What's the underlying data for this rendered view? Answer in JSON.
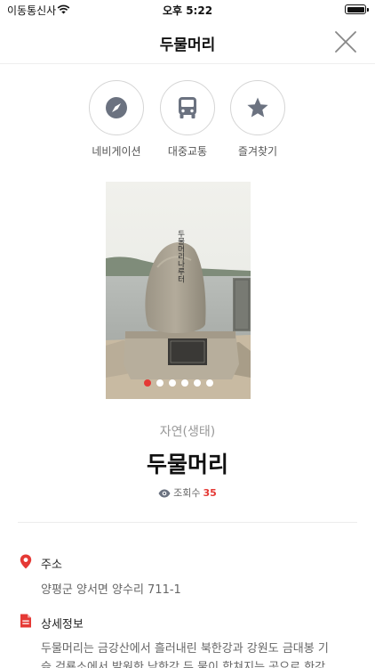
{
  "status_bar": {
    "carrier": "이동통신사",
    "time": "오후 5:22"
  },
  "nav": {
    "title": "두물머리"
  },
  "actions": [
    {
      "label": "네비게이션",
      "icon": "compass-icon"
    },
    {
      "label": "대중교통",
      "icon": "bus-icon"
    },
    {
      "label": "즐겨찾기",
      "icon": "star-icon"
    }
  ],
  "photo": {
    "stone_text": "두물머리나루터",
    "slide_count": 6,
    "active_slide": 1
  },
  "place": {
    "category": "자연(생태)",
    "name": "두물머리",
    "views_label": "조회수",
    "views_count": "35"
  },
  "address": {
    "title": "주소",
    "value": "양평군 양서면 양수리 711-1"
  },
  "details": {
    "title": "상세정보",
    "line1": "두물머리는 금강산에서 흘러내린 북한강과 강원도 금대봉 기",
    "line2": "슭 검룡소에서 발원한 남한강 두 물이 합쳐지는 곳으로 한강"
  },
  "colors": {
    "accent": "#e53935",
    "icon_gray": "#6b7280",
    "text_gray": "#666666"
  }
}
